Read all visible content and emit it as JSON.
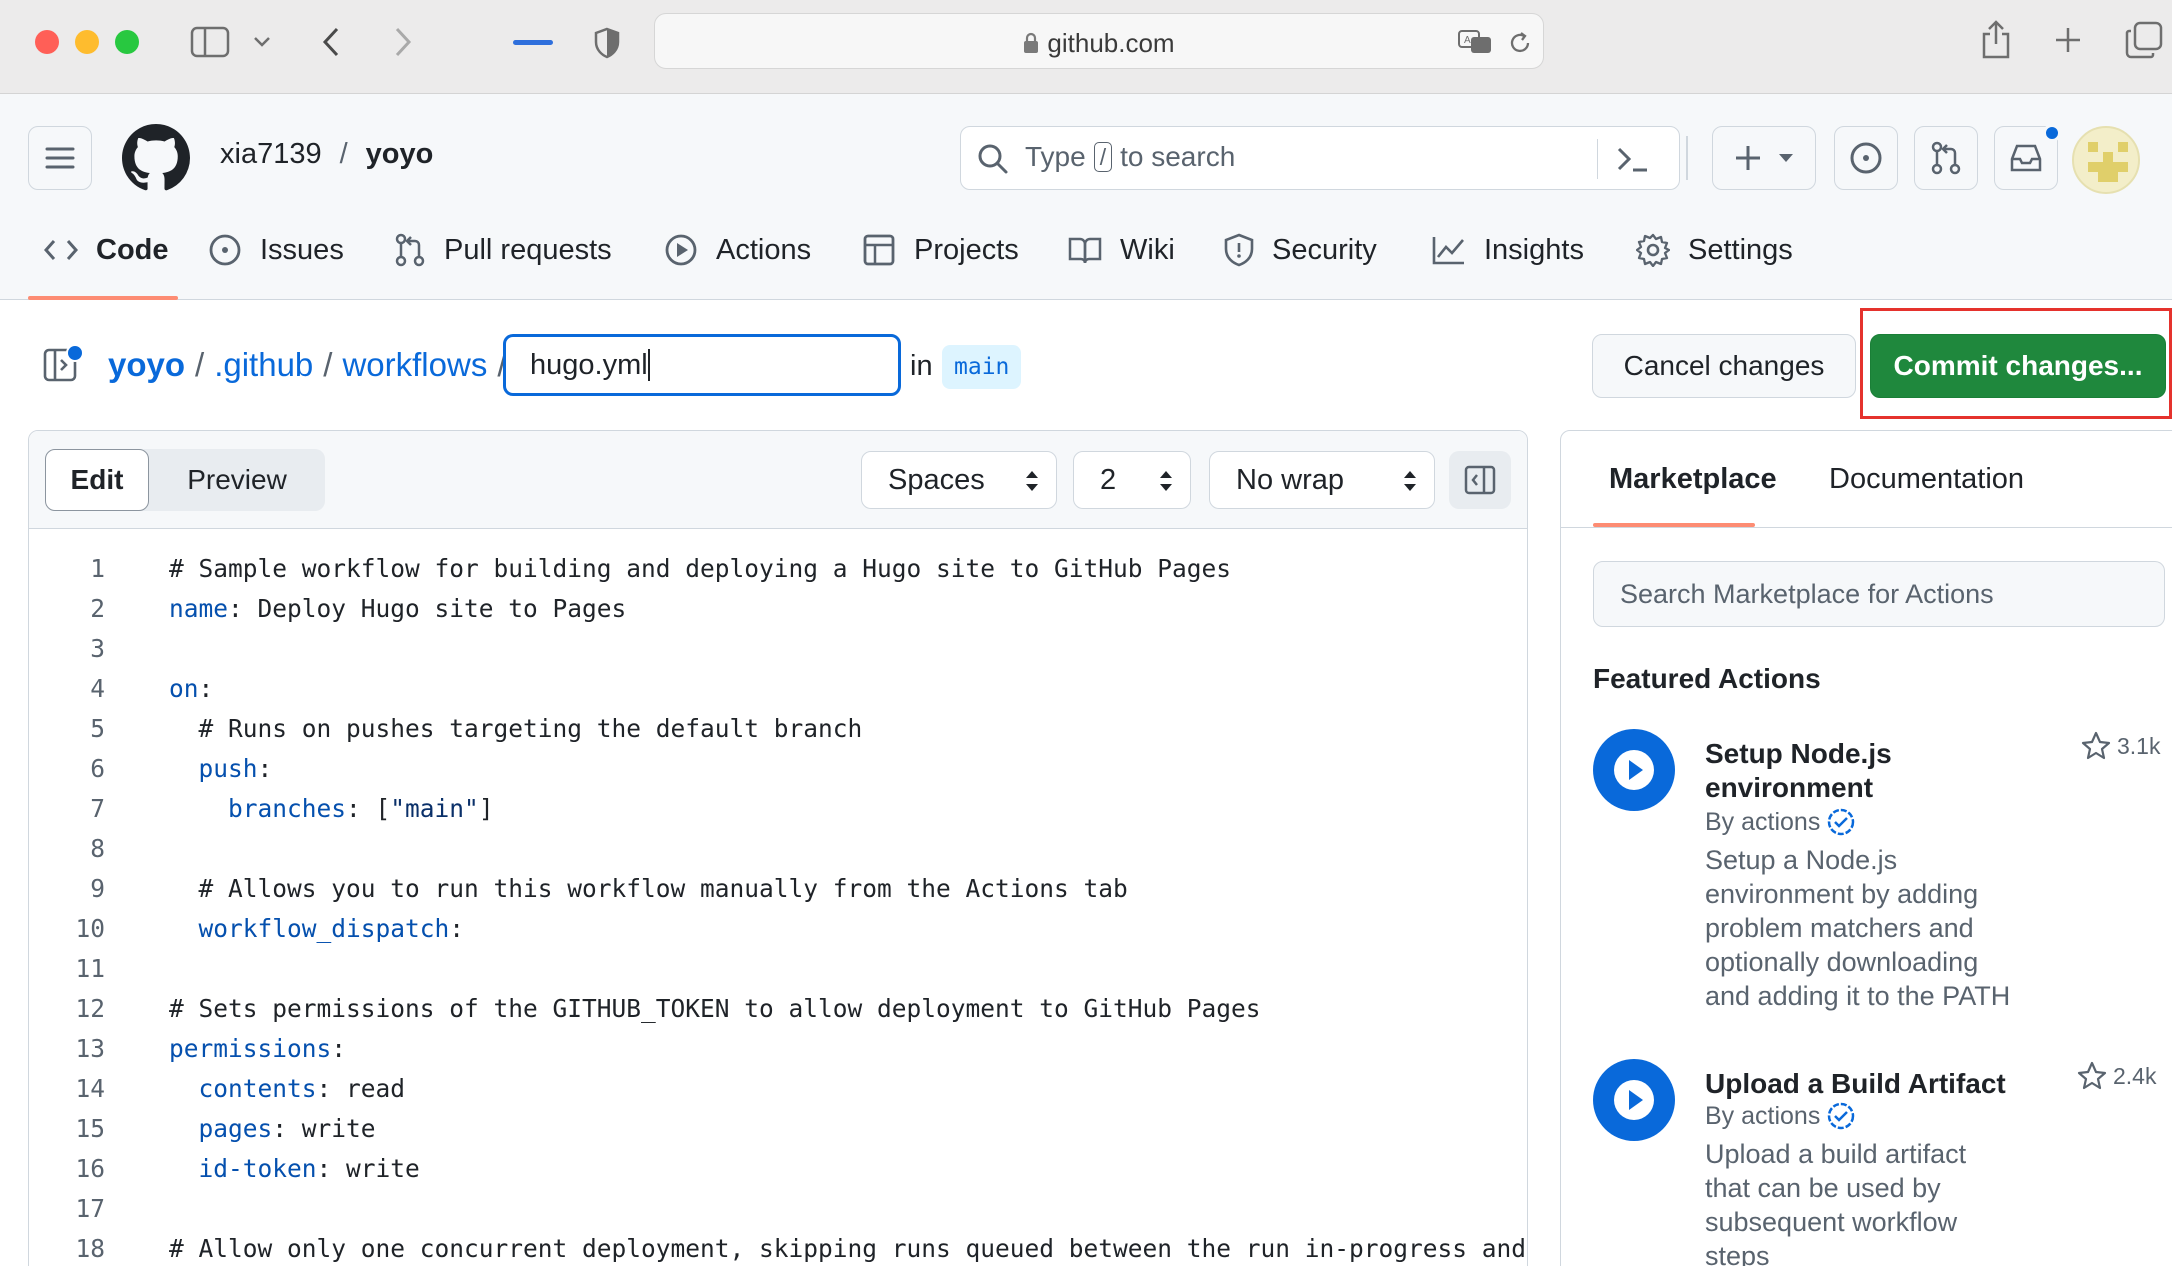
{
  "browser": {
    "url": "github.com"
  },
  "repo": {
    "owner": "xia7139",
    "separator": "/",
    "name": "yoyo"
  },
  "search": {
    "placeholder_before": "Type",
    "placeholder_key": "/",
    "placeholder_after": "to search"
  },
  "nav": {
    "items": [
      {
        "label": "Code",
        "icon": "code-icon"
      },
      {
        "label": "Issues",
        "icon": "issue-icon"
      },
      {
        "label": "Pull requests",
        "icon": "pull-request-icon"
      },
      {
        "label": "Actions",
        "icon": "play-icon"
      },
      {
        "label": "Projects",
        "icon": "table-icon"
      },
      {
        "label": "Wiki",
        "icon": "book-icon"
      },
      {
        "label": "Security",
        "icon": "shield-icon"
      },
      {
        "label": "Insights",
        "icon": "graph-icon"
      },
      {
        "label": "Settings",
        "icon": "gear-icon"
      }
    ]
  },
  "breadcrumb": {
    "repo": "yoyo",
    "dir1": ".github",
    "dir2": "workflows",
    "sep": "/",
    "filename": "hugo.yml",
    "in_label": "in",
    "branch": "main"
  },
  "actions": {
    "cancel": "Cancel changes",
    "commit": "Commit changes..."
  },
  "editor": {
    "tab_edit": "Edit",
    "tab_preview": "Preview",
    "indent_mode": "Spaces",
    "indent_size": "2",
    "wrap_mode": "No wrap",
    "lines": [
      {
        "n": "1",
        "parts": [
          [
            "",
            "# Sample workflow for building and deploying a Hugo site to GitHub Pages"
          ]
        ]
      },
      {
        "n": "2",
        "parts": [
          [
            "k",
            "name"
          ],
          [
            "",
            ": Deploy Hugo site to Pages"
          ]
        ]
      },
      {
        "n": "3",
        "parts": [
          [
            "",
            ""
          ]
        ]
      },
      {
        "n": "4",
        "parts": [
          [
            "k",
            "on"
          ],
          [
            "",
            ":"
          ]
        ]
      },
      {
        "n": "5",
        "parts": [
          [
            "",
            "  # Runs on pushes targeting the default branch"
          ]
        ]
      },
      {
        "n": "6",
        "parts": [
          [
            "",
            "  "
          ],
          [
            "k",
            "push"
          ],
          [
            "",
            ":"
          ]
        ]
      },
      {
        "n": "7",
        "parts": [
          [
            "",
            "    "
          ],
          [
            "k",
            "branches"
          ],
          [
            "",
            ": ["
          ],
          [
            "s",
            "\"main\""
          ],
          [
            "",
            "]"
          ]
        ]
      },
      {
        "n": "8",
        "parts": [
          [
            "",
            ""
          ]
        ]
      },
      {
        "n": "9",
        "parts": [
          [
            "",
            "  # Allows you to run this workflow manually from the Actions tab"
          ]
        ]
      },
      {
        "n": "10",
        "parts": [
          [
            "",
            "  "
          ],
          [
            "k",
            "workflow_dispatch"
          ],
          [
            "",
            ":"
          ]
        ]
      },
      {
        "n": "11",
        "parts": [
          [
            "",
            ""
          ]
        ]
      },
      {
        "n": "12",
        "parts": [
          [
            "",
            "# Sets permissions of the GITHUB_TOKEN to allow deployment to GitHub Pages"
          ]
        ]
      },
      {
        "n": "13",
        "parts": [
          [
            "k",
            "permissions"
          ],
          [
            "",
            ":"
          ]
        ]
      },
      {
        "n": "14",
        "parts": [
          [
            "",
            "  "
          ],
          [
            "k",
            "contents"
          ],
          [
            "",
            ": read"
          ]
        ]
      },
      {
        "n": "15",
        "parts": [
          [
            "",
            "  "
          ],
          [
            "k",
            "pages"
          ],
          [
            "",
            ": write"
          ]
        ]
      },
      {
        "n": "16",
        "parts": [
          [
            "",
            "  "
          ],
          [
            "k",
            "id-token"
          ],
          [
            "",
            ": write"
          ]
        ]
      },
      {
        "n": "17",
        "parts": [
          [
            "",
            ""
          ]
        ]
      },
      {
        "n": "18",
        "parts": [
          [
            "",
            "# Allow only one concurrent deployment, skipping runs queued between the run in-progress and"
          ]
        ]
      }
    ]
  },
  "sidebar": {
    "tab_marketplace": "Marketplace",
    "tab_documentation": "Documentation",
    "search_placeholder": "Search Marketplace for Actions",
    "featured_heading": "Featured Actions",
    "items": [
      {
        "title_line1": "Setup Node.js",
        "title_line2": "environment",
        "by": "By actions",
        "stars": "3.1k",
        "desc": [
          "Setup a Node.js",
          "environment by adding",
          "problem matchers and",
          "optionally downloading",
          "and adding it to the PATH"
        ]
      },
      {
        "title_line1": "Upload a Build Artifact",
        "title_line2": "",
        "by": "By actions",
        "stars": "2.4k",
        "desc": [
          "Upload a build artifact",
          "that can be used by",
          "subsequent workflow",
          "steps"
        ]
      }
    ]
  },
  "colors": {
    "accent": "#0969da",
    "commit_green": "#1f883d",
    "highlight_red": "#e5322d",
    "nav_underline": "#fd8c73"
  }
}
